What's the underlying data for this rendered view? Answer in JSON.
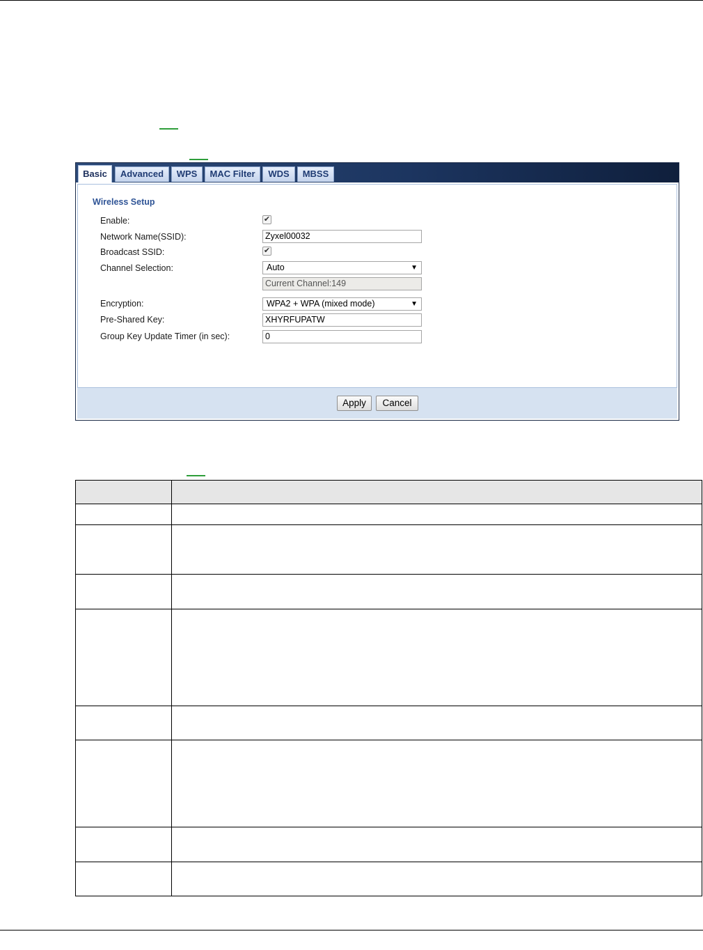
{
  "tabs": [
    {
      "label": "Basic",
      "active": true
    },
    {
      "label": "Advanced",
      "active": false
    },
    {
      "label": "WPS",
      "active": false
    },
    {
      "label": "MAC Filter",
      "active": false
    },
    {
      "label": "WDS",
      "active": false
    },
    {
      "label": "MBSS",
      "active": false
    }
  ],
  "wireless_setup": {
    "title": "Wireless Setup",
    "enable": {
      "label": "Enable:",
      "checked": true
    },
    "ssid": {
      "label": "Network Name(SSID):",
      "value": "Zyxel00032"
    },
    "broadcast_ssid": {
      "label": "Broadcast SSID:",
      "checked": true
    },
    "channel_selection": {
      "label": "Channel Selection:",
      "value": "Auto",
      "current_channel": "Current Channel:149"
    },
    "encryption": {
      "label": "Encryption:",
      "value": "WPA2 + WPA (mixed mode)"
    },
    "pre_shared_key": {
      "label": "Pre-Shared Key:",
      "value": "XHYRFUPATW"
    },
    "group_key_timer": {
      "label": "Group Key Update Timer (in sec):",
      "value": "0"
    }
  },
  "buttons": {
    "apply": "Apply",
    "cancel": "Cancel"
  },
  "icons": {
    "check": "checkmark-icon",
    "dropdown": "caret-down-icon"
  },
  "colors": {
    "link_accent": "#2e9e3a",
    "tab_text": "#1f3b73",
    "section_title": "#2f5496"
  }
}
